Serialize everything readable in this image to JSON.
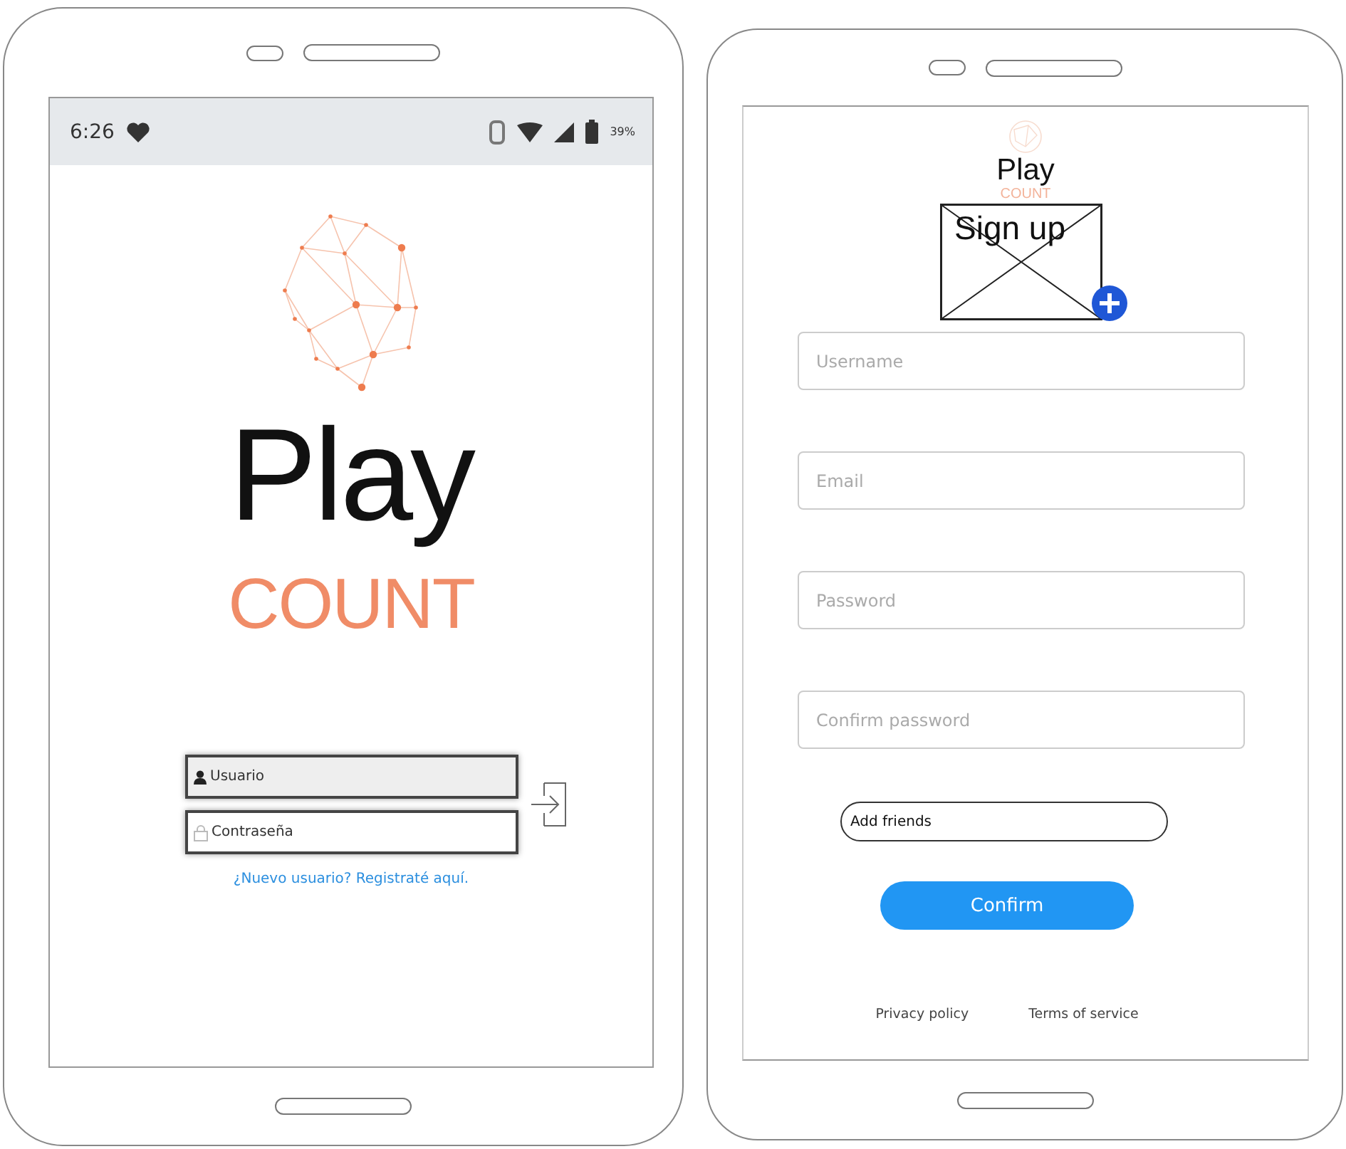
{
  "login_phone": {
    "status_bar": {
      "time": "6:26",
      "battery": "39%"
    },
    "logo": {
      "title": "Play",
      "subtitle": "COUNT"
    },
    "fields": [
      {
        "kind": "user",
        "placeholder": "Usuario"
      },
      {
        "kind": "password",
        "placeholder": "Contraseña"
      }
    ],
    "register_link": "¿Nuevo usuario? Registraté aquí."
  },
  "signup_phone": {
    "logo": {
      "title": "Play",
      "subtitle": "COUNT"
    },
    "title": "Sign up",
    "fields": [
      {
        "placeholder": "Username"
      },
      {
        "placeholder": "Email"
      },
      {
        "placeholder": "Password"
      },
      {
        "placeholder": "Confirm password"
      }
    ],
    "add_friends": "Add friends",
    "confirm": "Confirm",
    "footer_links": [
      "Privacy policy",
      "Terms of service"
    ]
  }
}
